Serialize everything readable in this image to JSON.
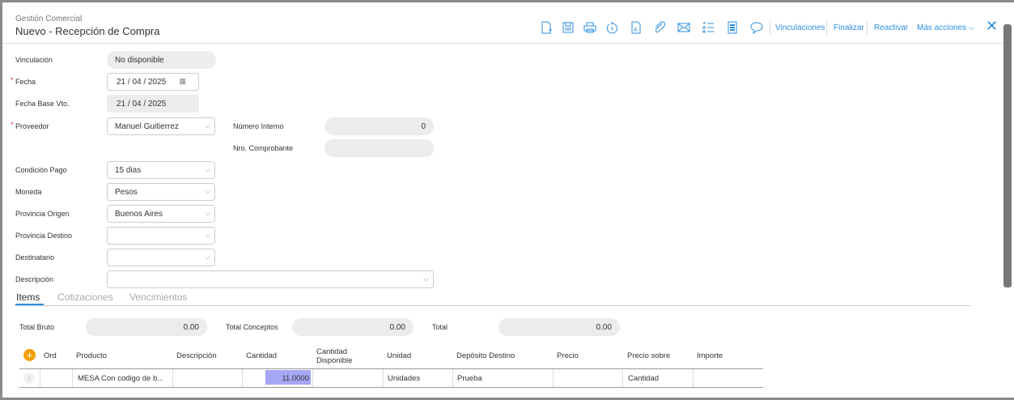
{
  "header": {
    "module": "Gestión Comercial",
    "title": "Nuevo - Recepción de Compra"
  },
  "toolbar": {
    "icons": [
      "new-document-icon",
      "save-icon",
      "print-icon",
      "history-icon",
      "text-document-icon",
      "attachment-icon",
      "mail-icon",
      "checklist-icon",
      "notebook-icon",
      "comment-icon"
    ],
    "vinculaciones": "Vinculaciones",
    "finalizar": "Finalizar",
    "reactivar": "Reactivar",
    "mas_acciones": "Más acciones",
    "accent": "#2d8fe0"
  },
  "form": {
    "vinculacion": {
      "label": "Vinculación",
      "value": "No disponible"
    },
    "fecha": {
      "label": "Fecha",
      "value": "21 / 04 / 2025"
    },
    "fecha_base": {
      "label": "Fecha Base Vto.",
      "value": "21 / 04 / 2025"
    },
    "proveedor": {
      "label": "Proveedor",
      "value": "Manuel Guitierrez"
    },
    "numero_interno": {
      "label": "Número Interno",
      "value": "0"
    },
    "nro_comprobante": {
      "label": "Nro. Comprobante",
      "value": ""
    },
    "condicion_pago": {
      "label": "Condición Pago",
      "value": "15 dias"
    },
    "moneda": {
      "label": "Moneda",
      "value": "Pesos"
    },
    "provincia_origen": {
      "label": "Provincia Origen",
      "value": "Buenos Aires"
    },
    "provincia_destino": {
      "label": "Provincia Destino",
      "value": ""
    },
    "destinatario": {
      "label": "Destinatario",
      "value": ""
    },
    "descripcion": {
      "label": "Descripción",
      "value": ""
    }
  },
  "tabs": [
    "Items",
    "Cotizaciones",
    "Vencimientos"
  ],
  "totals": {
    "bruto_label": "Total Bruto",
    "bruto": "0.00",
    "conceptos_label": "Total Conceptos",
    "conceptos": "0.00",
    "total_label": "Total",
    "total": "0.00"
  },
  "table": {
    "headers": [
      "Ord",
      "Producto",
      "Descripción",
      "Cantidad",
      "Cantidad Disponible",
      "Unidad",
      "Depósito Destino",
      "Precio",
      "Precio sobre",
      "Importe"
    ],
    "rows": [
      {
        "ord": "",
        "producto": "MESA Con codigo de b...",
        "descripcion": "",
        "cantidad": "11.0000",
        "disponible": "",
        "unidad": "Unidades",
        "deposito": "Prueba",
        "precio": "",
        "precio_sobre": "Cantidad",
        "importe": ""
      }
    ]
  }
}
